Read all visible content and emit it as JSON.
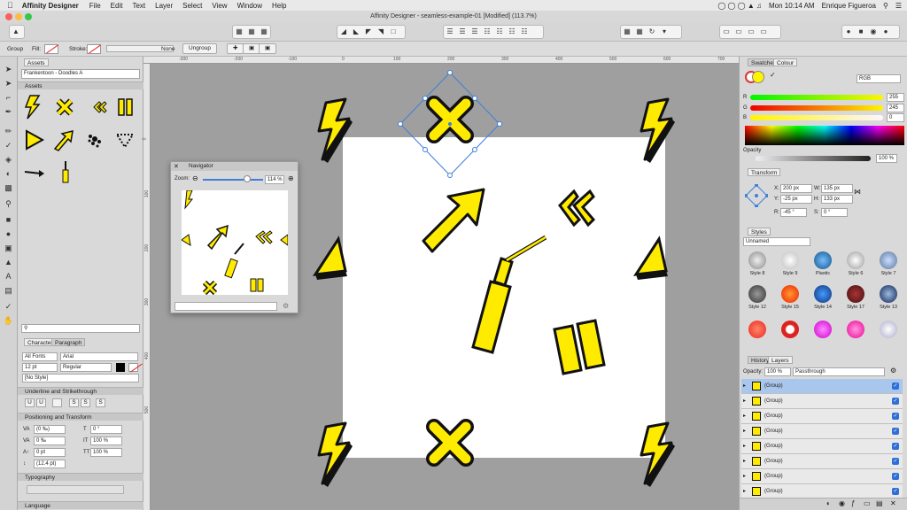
{
  "menubar": {
    "app": "Affinity Designer",
    "items": [
      "File",
      "Edit",
      "Text",
      "Layer",
      "Select",
      "View",
      "Window",
      "Help"
    ],
    "clock": "Mon 10:14 AM",
    "user": "Enrique Figueroa"
  },
  "window": {
    "title": "Affinity Designer - seamless-example-01 [Modified] (113.7%)"
  },
  "context": {
    "group_label": "Group",
    "fill_label": "Fill:",
    "stroke_label": "Stroke:",
    "stroke_value": "None",
    "ungroup_label": "Ungroup"
  },
  "ruler": {
    "top": [
      "-300",
      "-200",
      "-100",
      "0",
      "100",
      "200",
      "300",
      "400",
      "500",
      "600",
      "700"
    ],
    "left": [
      "-100",
      "0",
      "100",
      "200",
      "300",
      "400",
      "500"
    ]
  },
  "assets": {
    "tab": "Assets",
    "dropdown": "Frankentoon - Doodles A",
    "section": "Assets"
  },
  "character": {
    "tabs": [
      "Character",
      "Paragraph"
    ],
    "font_collection": "All Fonts",
    "font": "Arial",
    "size": "12 pt",
    "weight": "Regular",
    "style": "[No Style]",
    "sec_underline": "Underline and Strikethrough",
    "sec_positioning": "Positioning and Transform",
    "kerning": "(0 ‰)",
    "tracking": "0 ‰",
    "skew": "0 °",
    "baseline": "0 pt",
    "vscale": "100 %",
    "hscale": "100 %",
    "leading": "(12.4 pt)",
    "sec_typography": "Typography",
    "sec_language": "Language",
    "btn_u": "U",
    "btn_u2": "U",
    "btn_s": "S",
    "btn_s2": "S",
    "btn_s3": "S"
  },
  "navigator": {
    "title": "Navigator",
    "zoom_label": "Zoom:",
    "zoom_value": "114 %"
  },
  "colour": {
    "tabs": [
      "Swatches",
      "Colour"
    ],
    "model": "RGB",
    "r_label": "R",
    "g_label": "G",
    "b_label": "B",
    "r": "255",
    "g": "245",
    "b": "0",
    "opacity_label": "Opacity",
    "opacity": "100 %",
    "accent": "#2f6fd6"
  },
  "transform": {
    "tab": "Transform",
    "x_label": "X:",
    "y_label": "Y:",
    "w_label": "W:",
    "h_label": "H:",
    "r_label": "R:",
    "s_label": "S:",
    "x": "200 px",
    "y": "-25 px",
    "w": "135 px",
    "h": "133 px",
    "r": "-45 °",
    "s": "0 °"
  },
  "styles": {
    "tab": "Styles",
    "category": "Unnamed",
    "items": [
      "Style 8",
      "Style 9",
      "Plastic",
      "Style 6",
      "Style 7",
      "Style 12",
      "Style 15",
      "Style 14",
      "Style 17",
      "Style 13",
      "",
      "",
      "",
      "",
      ""
    ]
  },
  "layers": {
    "tabs": [
      "History",
      "Layers"
    ],
    "opacity_label": "Opacity:",
    "opacity": "100 %",
    "blend": "Passthrough",
    "rows": [
      "(Group)",
      "(Group)",
      "(Group)",
      "(Group)",
      "(Group)",
      "(Group)",
      "(Group)",
      "(Group)"
    ]
  }
}
